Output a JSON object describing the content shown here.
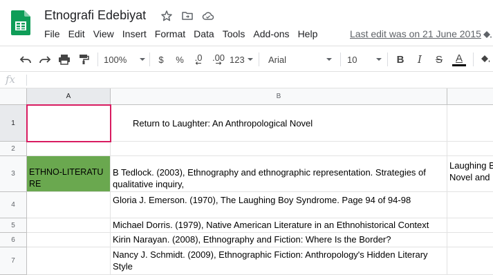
{
  "app": {
    "doc_title": "Etnografi Edebiyat",
    "last_edit": "Last edit was on 21 June 2015",
    "brand_color": "#0f9d58"
  },
  "menu": [
    "File",
    "Edit",
    "View",
    "Insert",
    "Format",
    "Data",
    "Tools",
    "Add-ons",
    "Help"
  ],
  "toolbar": {
    "zoom": "100%",
    "currency": "$",
    "percent": "%",
    "decrease_decimal": ".0",
    "increase_decimal": ".00",
    "more_formats": "123",
    "font": "Arial",
    "font_size": "10",
    "bold": "B",
    "italic": "I",
    "strike": "S",
    "text_color_label": "A"
  },
  "formula_bar": {
    "fx": "fx",
    "value": ""
  },
  "columns": [
    "A",
    "B"
  ],
  "rows": [
    "1",
    "2",
    "3",
    "4",
    "5",
    "6",
    "7"
  ],
  "cells": {
    "b1": "Return to Laughter: An Anthropological Novel",
    "a3": "ETHNO-LITERATURE",
    "b3": "B Tedlock. (2003), Ethnography and ethnographic representation. Strategies of qualitative inquiry,",
    "c3": "Laughing Boy: Novel and",
    "b4": "Gloria J. Emerson. (1970), The Laughing Boy Syndrome. Page 94 of 94-98",
    "b5": "Michael Dorris. (1979), Native American Literature in an Ethnohistorical Context",
    "b6": "Kirin Narayan. (2008), Ethnography and Fiction: Where Is the Border?",
    "b7": "Nancy J. Schmidt. (2009), Ethnographic Fiction: Anthropology's Hidden Literary Style"
  },
  "colors": {
    "selection": "#d81b60",
    "green_fill": "#6aa84f"
  }
}
